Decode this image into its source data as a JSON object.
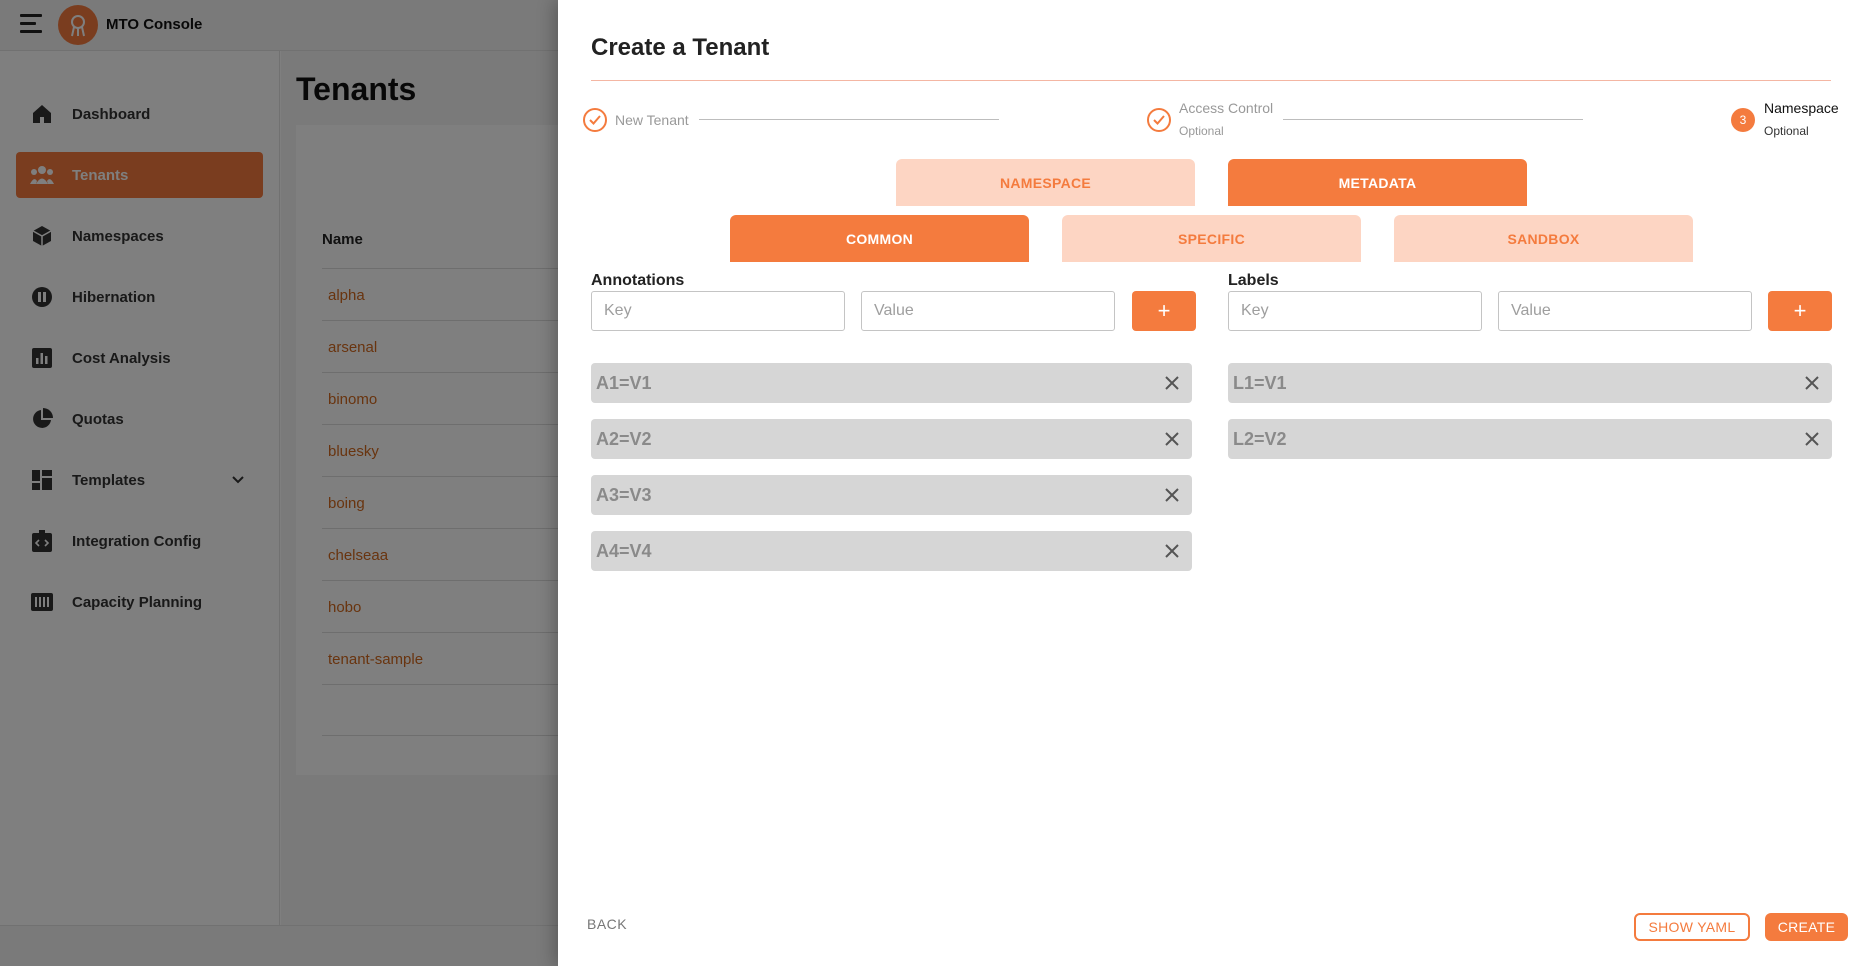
{
  "app": {
    "title": "MTO Console",
    "accent_color": "#f47b3e",
    "sidebar": {
      "items": [
        {
          "label": "Dashboard",
          "icon": "home-icon"
        },
        {
          "label": "Tenants",
          "icon": "users-icon",
          "active": true
        },
        {
          "label": "Namespaces",
          "icon": "cube-icon"
        },
        {
          "label": "Hibernation",
          "icon": "pause-icon"
        },
        {
          "label": "Cost Analysis",
          "icon": "bar-chart-icon"
        },
        {
          "label": "Quotas",
          "icon": "pie-chart-icon"
        },
        {
          "label": "Templates",
          "icon": "dashboard-grid-icon",
          "expandable": true
        },
        {
          "label": "Integration Config",
          "icon": "integration-icon"
        },
        {
          "label": "Capacity Planning",
          "icon": "capacity-icon"
        }
      ]
    },
    "page_title": "Tenants",
    "table": {
      "column_name": "Name",
      "rows": [
        "alpha",
        "arsenal",
        "binomo",
        "bluesky",
        "boing",
        "chelseaa",
        "hobo",
        "tenant-sample"
      ]
    }
  },
  "drawer": {
    "title": "Create a Tenant",
    "stepper": [
      {
        "label": "New Tenant",
        "sub": "",
        "state": "completed"
      },
      {
        "label": "Access Control",
        "sub": "Optional",
        "state": "completed"
      },
      {
        "label": "Namespace",
        "sub": "Optional",
        "state": "current",
        "number": "3"
      }
    ],
    "primary_tabs": [
      {
        "label": "NAMESPACE",
        "active": false
      },
      {
        "label": "METADATA",
        "active": true
      }
    ],
    "secondary_tabs": [
      {
        "label": "COMMON",
        "active": true
      },
      {
        "label": "SPECIFIC",
        "active": false
      },
      {
        "label": "SANDBOX",
        "active": false
      }
    ],
    "annotations": {
      "label": "Annotations",
      "key_placeholder": "Key",
      "value_placeholder": "Value",
      "add_label": "+",
      "items": [
        "A1=V1",
        "A2=V2",
        "A3=V3",
        "A4=V4"
      ]
    },
    "labels": {
      "label": "Labels",
      "key_placeholder": "Key",
      "value_placeholder": "Value",
      "add_label": "+",
      "items": [
        "L1=V1",
        "L2=V2"
      ]
    },
    "footer": {
      "back_label": "BACK",
      "show_yaml_label": "SHOW YAML",
      "create_label": "CREATE"
    }
  }
}
